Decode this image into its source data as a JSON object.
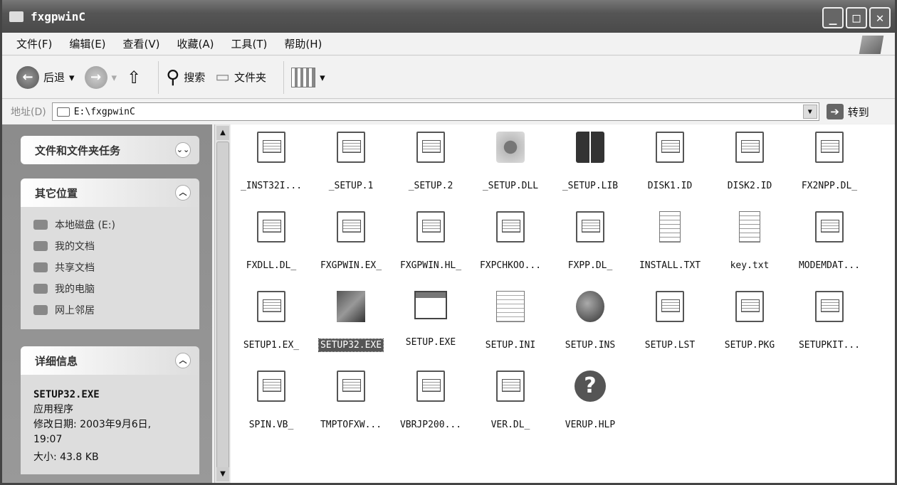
{
  "window": {
    "title": "fxgpwinC"
  },
  "menu": [
    "文件(F)",
    "编辑(E)",
    "查看(V)",
    "收藏(A)",
    "工具(T)",
    "帮助(H)"
  ],
  "toolbar": {
    "back": "后退",
    "search": "搜索",
    "folders": "文件夹"
  },
  "address": {
    "label": "地址(D)",
    "value": "E:\\fxgpwinC",
    "go": "转到"
  },
  "tasks": {
    "title": "文件和文件夹任务"
  },
  "places": {
    "title": "其它位置",
    "items": [
      "本地磁盘 (E:)",
      "我的文档",
      "共享文档",
      "我的电脑",
      "网上邻居"
    ]
  },
  "details": {
    "title": "详细信息",
    "name": "SETUP32.EXE",
    "type": "应用程序",
    "modified": "修改日期: 2003年9月6日,",
    "time": "19:07",
    "size": "大小: 43.8 KB"
  },
  "files": [
    {
      "name": "_INST32I...",
      "icon": "gen"
    },
    {
      "name": "_SETUP.1",
      "icon": "gen"
    },
    {
      "name": "_SETUP.2",
      "icon": "gen"
    },
    {
      "name": "_SETUP.DLL",
      "icon": "gear"
    },
    {
      "name": "_SETUP.LIB",
      "icon": "book"
    },
    {
      "name": "DISK1.ID",
      "icon": "gen"
    },
    {
      "name": "DISK2.ID",
      "icon": "gen"
    },
    {
      "name": "FX2NPP.DL_",
      "icon": "gen"
    },
    {
      "name": "FXDLL.DL_",
      "icon": "gen"
    },
    {
      "name": "FXGPWIN.EX_",
      "icon": "gen"
    },
    {
      "name": "FXGPWIN.HL_",
      "icon": "gen"
    },
    {
      "name": "FXPCHKOO...",
      "icon": "gen"
    },
    {
      "name": "FXPP.DL_",
      "icon": "gen"
    },
    {
      "name": "INSTALL.TXT",
      "icon": "txt"
    },
    {
      "name": "key.txt",
      "icon": "txt"
    },
    {
      "name": "MODEMDAT...",
      "icon": "gen"
    },
    {
      "name": "SETUP1.EX_",
      "icon": "gen"
    },
    {
      "name": "SETUP32.EXE",
      "icon": "exe32",
      "selected": true
    },
    {
      "name": "SETUP.EXE",
      "icon": "wexe"
    },
    {
      "name": "SETUP.INI",
      "icon": "ini"
    },
    {
      "name": "SETUP.INS",
      "icon": "ins"
    },
    {
      "name": "SETUP.LST",
      "icon": "gen"
    },
    {
      "name": "SETUP.PKG",
      "icon": "gen"
    },
    {
      "name": "SETUPKIT...",
      "icon": "gen"
    },
    {
      "name": "SPIN.VB_",
      "icon": "gen"
    },
    {
      "name": "TMPTOFXW...",
      "icon": "gen"
    },
    {
      "name": "VBRJP200...",
      "icon": "gen"
    },
    {
      "name": "VER.DL_",
      "icon": "gen"
    },
    {
      "name": "VERUP.HLP",
      "icon": "hlp"
    }
  ]
}
